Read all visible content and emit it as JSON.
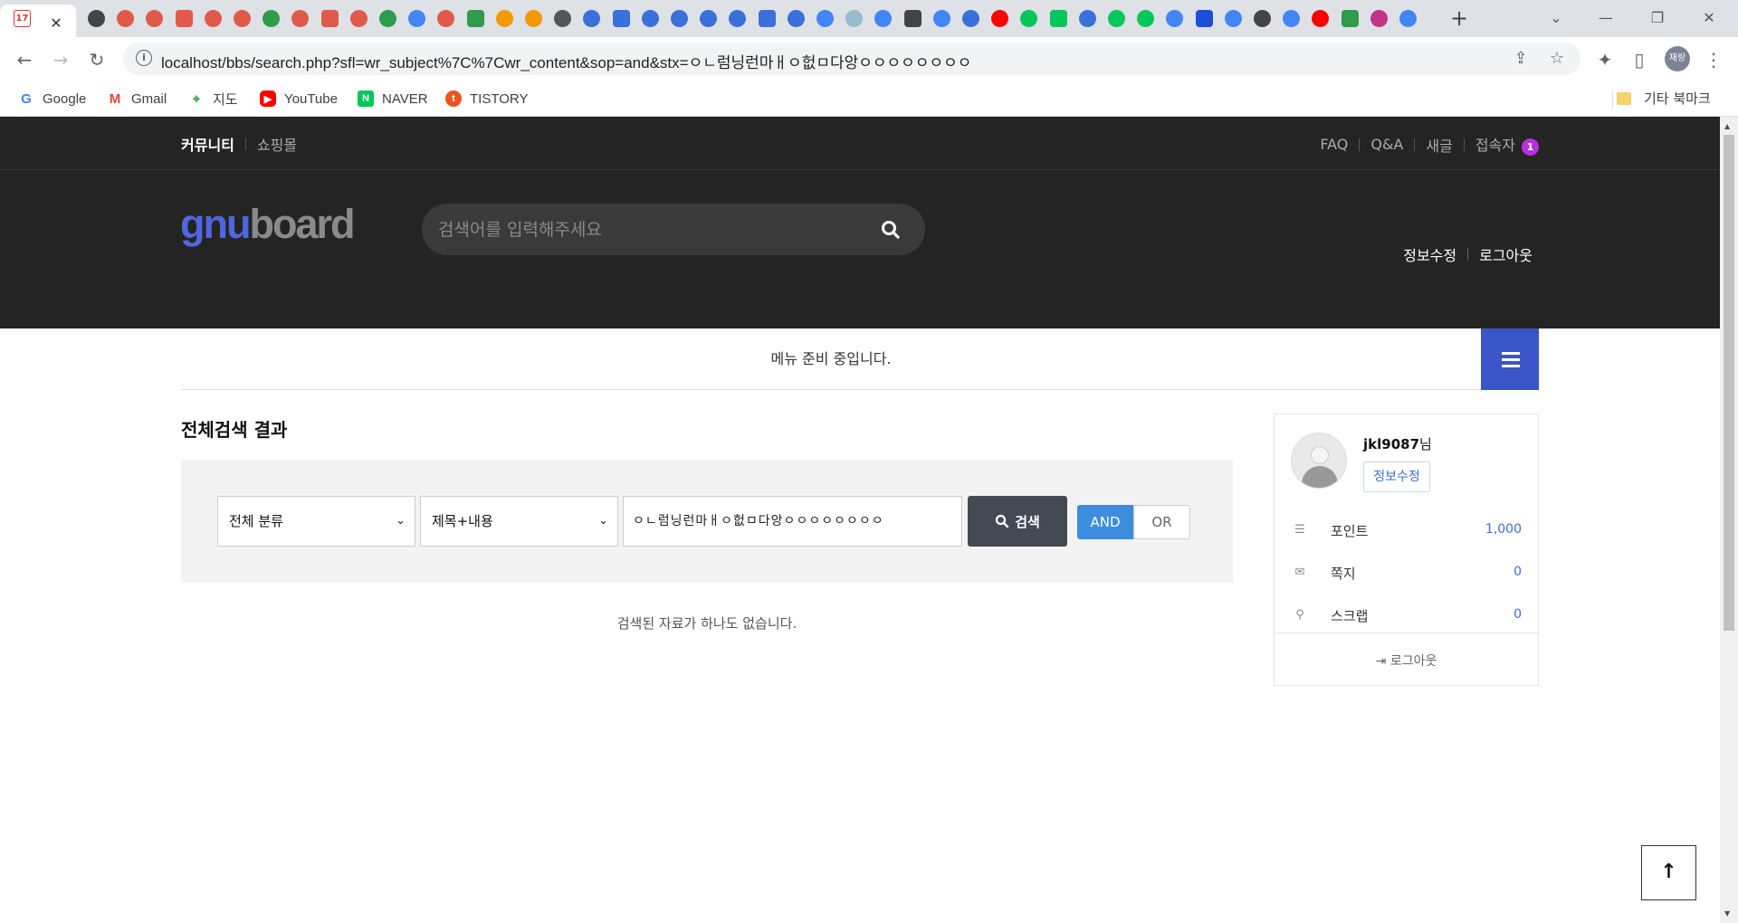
{
  "browser": {
    "active_tab_favicon": "calendar-17-icon",
    "calendar_day": "17",
    "tab_close": "✕",
    "new_tab": "+",
    "address": "localhost/bbs/search.php?sfl=wr_subject%7C%7Cwr_content&sop=and&stx=ㅇㄴ럼닝런마ㅐㅇ헚ㅁ다앙ㅇㅇㅇㅇㅇㅇㅇㅇ",
    "profile_label": "재랑",
    "bookmarks": [
      {
        "label": "Google",
        "icon": "google-icon",
        "color": "#4285f4"
      },
      {
        "label": "Gmail",
        "icon": "gmail-icon",
        "color": "#ea4335"
      },
      {
        "label": "지도",
        "icon": "maps-pin-icon",
        "color": "#34a853"
      },
      {
        "label": "YouTube",
        "icon": "youtube-icon",
        "color": "#ff0000"
      },
      {
        "label": "NAVER",
        "icon": "naver-icon",
        "color": "#03c75a"
      },
      {
        "label": "TISTORY",
        "icon": "tistory-icon",
        "color": "#eb531f"
      }
    ],
    "bookmark_folder": "기타 북마크"
  },
  "top_bar": {
    "community": "커뮤니티",
    "shop": "쇼핑몰",
    "links": [
      "FAQ",
      "Q&A",
      "새글",
      "접속자"
    ],
    "visitor_count": "1"
  },
  "header": {
    "logo_part1": "gnu",
    "logo_part2": "board",
    "search_placeholder": "검색어를 입력해주세요",
    "member_edit": "정보수정",
    "logout": "로그아웃"
  },
  "gnb": {
    "message": "메뉴 준비 중입니다."
  },
  "search": {
    "title": "전체검색 결과",
    "category_select": "전체 분류",
    "field_select": "제목+내용",
    "query": "ㅇㄴ럼닝런마ㅐㅇ헚ㅁ다앙ㅇㅇㅇㅇㅇㅇㅇㅇ",
    "button": "검색",
    "and_label": "AND",
    "or_label": "OR",
    "empty_message": "검색된 자료가 하나도 없습니다."
  },
  "profile": {
    "username": "jkl9087",
    "suffix": "님",
    "edit_button": "정보수정",
    "stats": [
      {
        "label": "포인트",
        "value": "1,000",
        "icon": "database-icon"
      },
      {
        "label": "쪽지",
        "value": "0",
        "icon": "envelope-icon"
      },
      {
        "label": "스크랩",
        "value": "0",
        "icon": "pin-icon"
      }
    ],
    "logout": "로그아웃"
  },
  "colors": {
    "accent": "#3a55c7",
    "logo_blue": "#5066e0",
    "badge": "#b92fe0",
    "and_button": "#3c8dde"
  }
}
